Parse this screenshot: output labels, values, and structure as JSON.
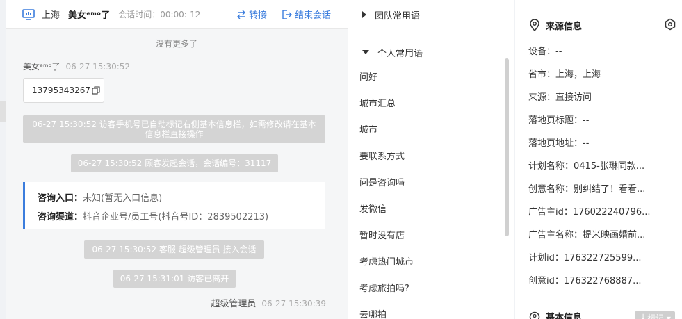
{
  "header": {
    "city": "上海",
    "visitor_name": "美女ᵉᵐᵒ了",
    "session_time": "会话时间：00:00:-12",
    "transfer": "转接",
    "end_session": "结束会话"
  },
  "chat": {
    "no_more": "没有更多了",
    "visitor_name": "美女ᵉᵐᵒ了",
    "visitor_time": "06-27 15:30:52",
    "phone": "13795343267",
    "sys_phone_note": "06-27 15:30:52 访客手机号已自动标记右侧基本信息栏，如需修改请在基本信息栏直接操作",
    "sys_session_start": "06-27 15:30:52 顾客发起会话，会话编号：31117",
    "entry_label": "咨询入口：",
    "entry_value": "未知(暂无入口信息)",
    "channel_label": "咨询渠道：",
    "channel_value": "抖音企业号/员工号(抖音号ID：2839502213)",
    "sys_agent_join": "06-27 15:30:52 客服 超级管理员 接入会话",
    "sys_visitor_left": "06-27 15:31:01 访客已离开",
    "agent_name": "超级管理员",
    "agent_time": "06-27 15:30:39"
  },
  "phrases": {
    "team_group": "团队常用语",
    "personal_group": "个人常用语",
    "items": [
      "问好",
      "城市汇总",
      "城市",
      "要联系方式",
      "问是咨询吗",
      "发微信",
      "暂时没有店",
      "考虑热门城市",
      "考虑旅拍吗?",
      "去哪拍"
    ]
  },
  "source": {
    "title": "来源信息",
    "rows": [
      "设备：--",
      "省市：上海，上海",
      "来源：直接访问",
      "落地页标题：--",
      "落地页地址：--",
      "计划名称：0415-张琳同款...",
      "创意名称：别纠结了！看看...",
      "广告主id：176022240796...",
      "广告主名称：提米映画婚前...",
      "计划id：176322725599...",
      "创意id：176322768887..."
    ],
    "basic_title": "基本信息",
    "tag_badge": "未标记 ▾"
  },
  "colors": {
    "accent": "#3b7ddd",
    "system_bubble": "#d4d4d4"
  }
}
